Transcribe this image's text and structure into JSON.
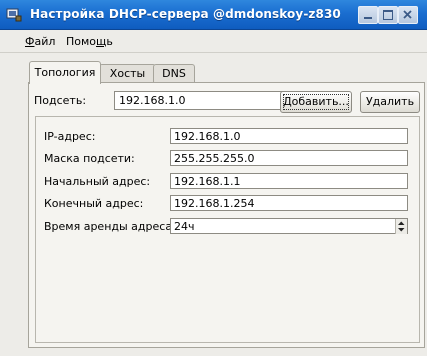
{
  "window": {
    "title": "Настройка DHCP-сервера @dmdonskoy-z830",
    "minimize_label": "",
    "maximize_label": "",
    "close_label": ""
  },
  "menu": {
    "file_u": "Ф",
    "file_rest": "айл",
    "help_pre": "Помо",
    "help_u": "щ",
    "help_rest": "ь"
  },
  "tabs": [
    {
      "label": "Топология",
      "active": true
    },
    {
      "label": "Хосты",
      "active": false
    },
    {
      "label": "DNS",
      "active": false
    }
  ],
  "subnet": {
    "label": "Подсеть:",
    "value": "192.168.1.0",
    "add_button": "Добавить...",
    "delete_button": "Удалить"
  },
  "form": [
    {
      "label": "IP-адрес:",
      "value": "192.168.1.0"
    },
    {
      "label": "Маска подсети:",
      "value": "255.255.255.0"
    },
    {
      "label": "Начальный адрес:",
      "value": "192.168.1.1"
    },
    {
      "label": "Конечный адрес:",
      "value": "192.168.1.254"
    },
    {
      "label": "Время аренды адреса:",
      "value": "24ч"
    }
  ],
  "icons": [
    "app-icon",
    "minimize-icon",
    "maximize-icon",
    "close-icon",
    "dropdown-arrow-icon",
    "spin-up-icon",
    "spin-down-icon"
  ]
}
